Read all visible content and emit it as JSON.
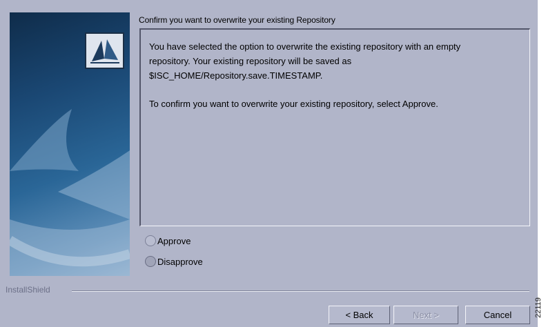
{
  "header": {
    "title": "Confirm you want to overwrite your existing Repository"
  },
  "message": {
    "line1": "You have selected the option to overwrite the existing repository with an empty",
    "line2": "repository. Your existing repository will be saved as",
    "line3": "$ISC_HOME/Repository.save.TIMESTAMP.",
    "line4": "To confirm you want to overwrite your existing repository, select Approve."
  },
  "options": {
    "approve": {
      "label": "Approve",
      "selected": false
    },
    "disapprove": {
      "label": "Disapprove",
      "selected": true
    }
  },
  "footer": {
    "brand": "InstallShield",
    "back_label": "< Back",
    "next_label": "Next >",
    "cancel_label": "Cancel"
  },
  "figure_id": "22119",
  "colors": {
    "dialog_bg": "#b1b5c9",
    "side_panel": "#1a4773"
  }
}
